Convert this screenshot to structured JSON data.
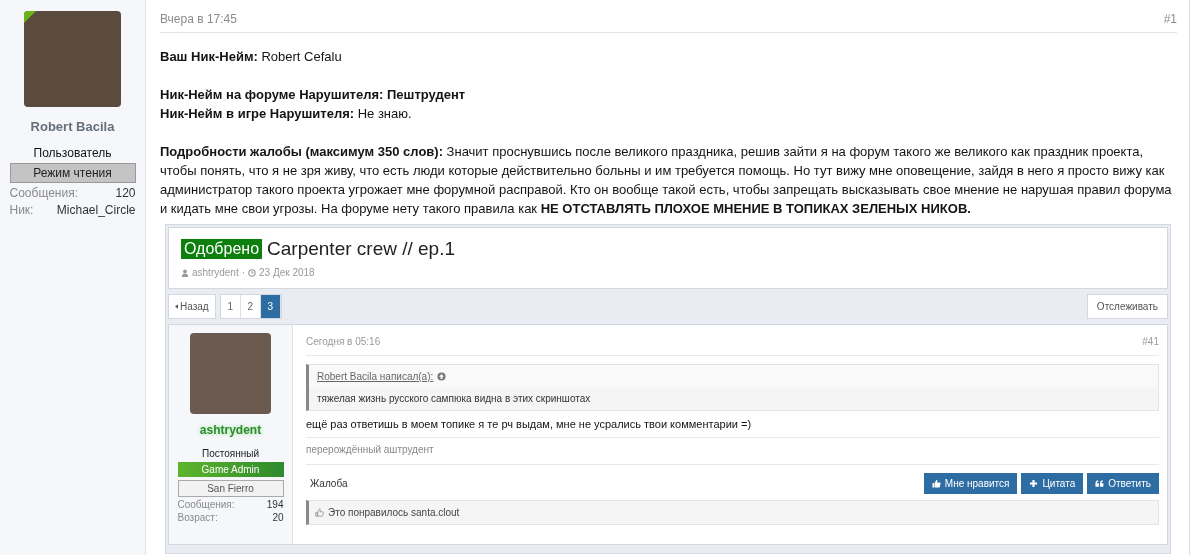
{
  "author": {
    "name": "Robert Bacila",
    "title": "Пользователь",
    "badge": "Режим чтения",
    "stats": [
      {
        "label": "Сообщения:",
        "value": "120"
      },
      {
        "label": "Ник:",
        "value": "Michael_Circle"
      }
    ]
  },
  "post": {
    "date": "Вчера в 17:45",
    "number": "#1",
    "blocks": [
      [
        "**Ваш Ник-Нейм:** Robert Cefalu"
      ],
      [
        "**Ник-Нейм на форуме Нарушителя: Пештрудент**",
        "**Ник-Нейм в игре Нарушителя:** Не знаю."
      ],
      [
        "**Подробности жалобы (максимум 350 слов):** Значит проснувшись после великого праздника, решив зайти я на форум такого же великого как праздник проекта, чтобы понять, что я не зря живу, что есть люди которые действительно больны и им требуется помощь. Но тут вижу мне оповещение, зайдя в него я просто вижу как администратор такого проекта угрожает мне форумной расправой. Кто он вообще такой есть, чтобы запрещать высказывать свое мнение не нарушая правил форума и кидать мне свои угрозы. На форуме нету такого правила как **НЕ ОТСТАВЛЯТЬ ПЛОХОЕ МНЕНИЕ В ТОПИКАХ ЗЕЛЕНЫХ НИКОВ.**"
      ]
    ]
  },
  "embed": {
    "thread": {
      "prefix": "Одобрено",
      "title": "Carpenter crew // ep.1",
      "author": "ashtrydent",
      "separator": "·",
      "date": "23 Дек 2018"
    },
    "back": "Назад",
    "pages": [
      {
        "label": "1",
        "selected": false
      },
      {
        "label": "2",
        "selected": false
      },
      {
        "label": "3",
        "selected": true
      }
    ],
    "watch": "Отслеживать",
    "post": {
      "author": {
        "name": "ashtrydent",
        "title": "Постоянный",
        "badges": [
          {
            "label": "Game Admin",
            "kind": "admin"
          },
          {
            "label": "San Fierro",
            "kind": "server"
          }
        ],
        "stats": [
          {
            "label": "Сообщения:",
            "value": "194"
          },
          {
            "label": "Возраст:",
            "value": "20"
          }
        ]
      },
      "date": "Сегодня в 05:16",
      "number": "#41",
      "quote": {
        "author": "Robert Bacila написал(а):",
        "text": "тяжелая жизнь русского сампюка видна в этих скриншотах"
      },
      "text": "ещё раз ответишь в моем топике я те рч выдам, мне не усрались твои комментарии =)",
      "signature": "перерождённый аштрудент",
      "report": "Жалоба",
      "actions": [
        {
          "label": "Мне нравится",
          "kind": "like"
        },
        {
          "label": "Цитата",
          "kind": "quote"
        },
        {
          "label": "Ответить",
          "kind": "reply"
        }
      ],
      "likes": "Это понравилось santa.clout"
    }
  }
}
